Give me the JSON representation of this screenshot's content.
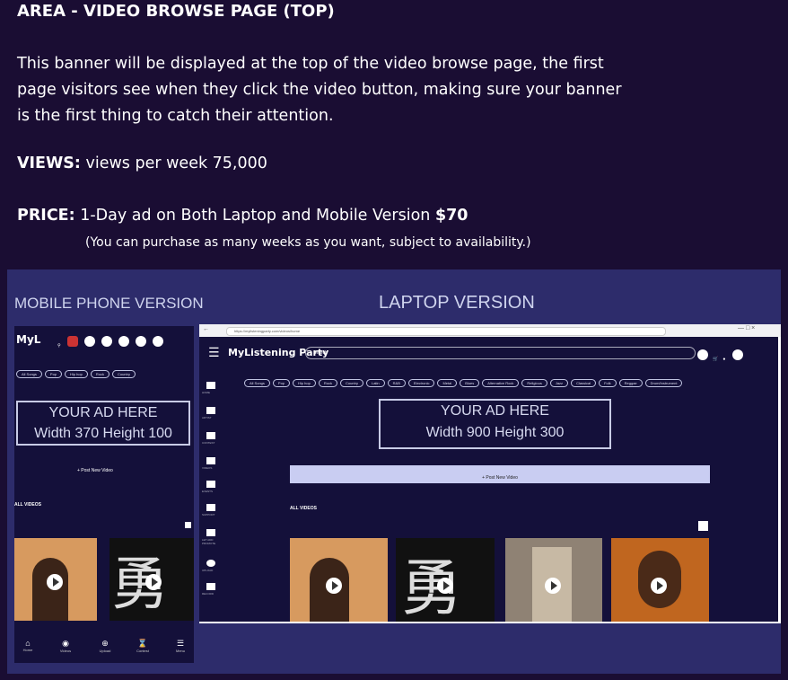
{
  "heading": "AREA - VIDEO BROWSE PAGE (TOP)",
  "description": "This banner will be displayed at the top of the video browse page, the first page visitors see when they click the video button, making sure your banner is the first thing to catch their attention.",
  "views": {
    "label": "VIEWS:",
    "text": "views per week 75,000"
  },
  "price": {
    "label": "PRICE:",
    "text": "1-Day ad on Both Laptop and Mobile Version",
    "amount": "$70"
  },
  "note": "(You can purchase as many weeks as you want, subject to availability.)",
  "mockups": {
    "mobile_label": "MOBILE PHONE VERSION",
    "laptop_label": "LAPTOP VERSION"
  },
  "mobile": {
    "logo": "MyL",
    "categories": [
      "All Songs",
      "Pop",
      "Hip hop",
      "Rock",
      "Country"
    ],
    "ad_line1": "YOUR AD HERE",
    "ad_line2": "Width 370 Height 100",
    "post_button": "+ Post New Video",
    "section": "ALL VIDEOS",
    "nav": [
      "Home",
      "Videos",
      "Upload",
      "Contest",
      "Menu"
    ]
  },
  "laptop": {
    "url": "https://mylisteningparty.com/videos/home",
    "logo": "MyListening Party",
    "search_placeholder": "Search",
    "categories": [
      "All Songs",
      "Pop",
      "Hip hop",
      "Rock",
      "Country",
      "Latin",
      "R&B",
      "Electronic",
      "Metal",
      "Blues",
      "Alternative Rock",
      "Religious",
      "Jazz",
      "Classical",
      "Folk",
      "Reggae",
      "Drum/Instrument"
    ],
    "ad_line1": "YOUR AD HERE",
    "ad_line2": "Width 900 Height 300",
    "post_button": "+ Post New Video",
    "section": "ALL VIDEOS",
    "sidebar": [
      "HOME",
      "ARTIST",
      "CONTEST",
      "VIDEOS",
      "EVENTS",
      "SUPPORT",
      "LET ADD PROMOTE",
      "UPLOAD",
      "RECORD"
    ]
  }
}
